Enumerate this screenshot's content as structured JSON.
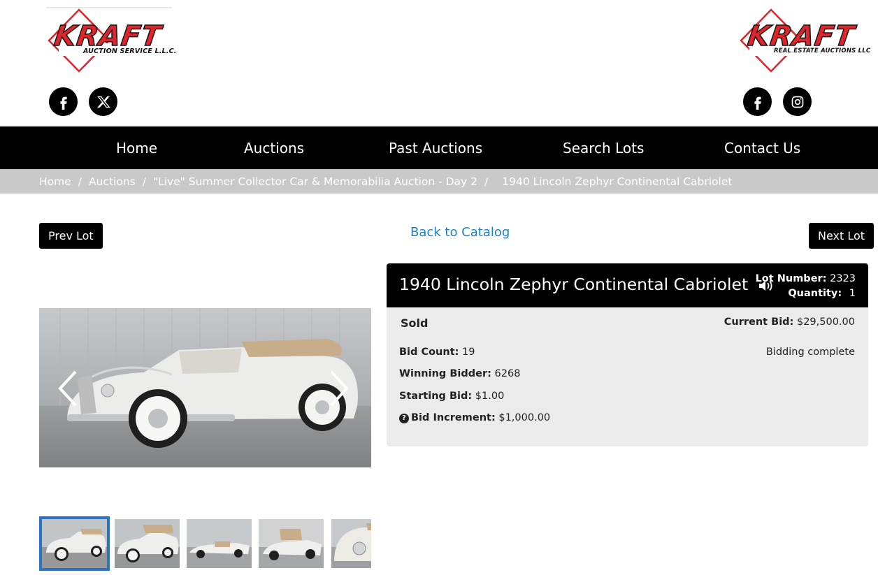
{
  "header": {
    "logo_left": {
      "word": "KRAFT",
      "sub": "AUCTION SERVICE L.L.C."
    },
    "logo_right": {
      "word": "KRAFT",
      "sub": "REAL ESTATE AUCTIONS LLC"
    },
    "brand_color": "#e0242b",
    "social_left": [
      "facebook-icon",
      "x-icon"
    ],
    "social_right": [
      "facebook-icon",
      "instagram-icon"
    ]
  },
  "nav": {
    "items": [
      "Home",
      "Auctions",
      "Past Auctions",
      "Search Lots",
      "Contact Us"
    ]
  },
  "breadcrumb": {
    "items": [
      "Home",
      "Auctions",
      "\"Live\" Summer Collector Car & Memorabilia Auction - Day 2"
    ],
    "current": "1940 Lincoln Zephyr Continental Cabriolet"
  },
  "lot_nav": {
    "prev_label": "Prev Lot",
    "back_label": "Back to Catalog",
    "next_label": "Next Lot",
    "link_color": "#1a82c9"
  },
  "lot": {
    "title": "1940 Lincoln Zephyr Continental Cabriolet",
    "lot_number_label": "Lot Number:",
    "lot_number": "2323",
    "quantity_label": "Quantity:",
    "quantity": "1",
    "status": "Sold",
    "current_bid_label": "Current Bid:",
    "current_bid": "$29,500.00",
    "bidding_status": "Bidding complete",
    "bid_count_label": "Bid Count:",
    "bid_count": "19",
    "winning_bidder_label": "Winning Bidder:",
    "winning_bidder": "6268",
    "starting_bid_label": "Starting Bid:",
    "starting_bid": "$1.00",
    "bid_increment_label": "Bid Increment:",
    "bid_increment": "$1,000.00"
  },
  "gallery": {
    "thumb_count": 5,
    "active_thumb": 1,
    "active_border_color": "#2f72c4"
  }
}
